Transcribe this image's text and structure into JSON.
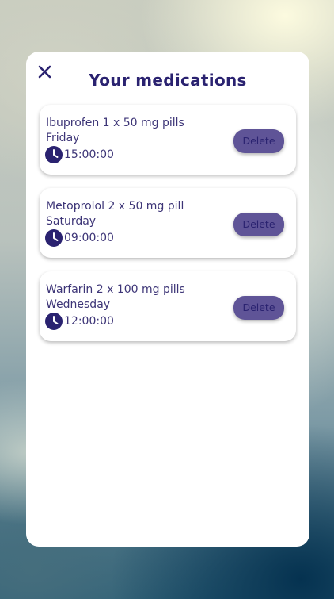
{
  "modal": {
    "title": "Your medications"
  },
  "medications": [
    {
      "name": "Ibuprofen 1 x 50 mg pills",
      "day": "Friday",
      "time": "15:00:00",
      "delete_label": "Delete"
    },
    {
      "name": "Metoprolol 2 x 50 mg pill",
      "day": "Saturday",
      "time": "09:00:00",
      "delete_label": "Delete"
    },
    {
      "name": "Warfarin 2 x 100 mg pills",
      "day": "Wednesday",
      "time": "12:00:00",
      "delete_label": "Delete"
    }
  ],
  "icons": {
    "close": "close-icon",
    "clock": "clock-icon"
  },
  "colors": {
    "primary": "#2a2270",
    "button": "#5f5497",
    "text": "#3d3577"
  }
}
